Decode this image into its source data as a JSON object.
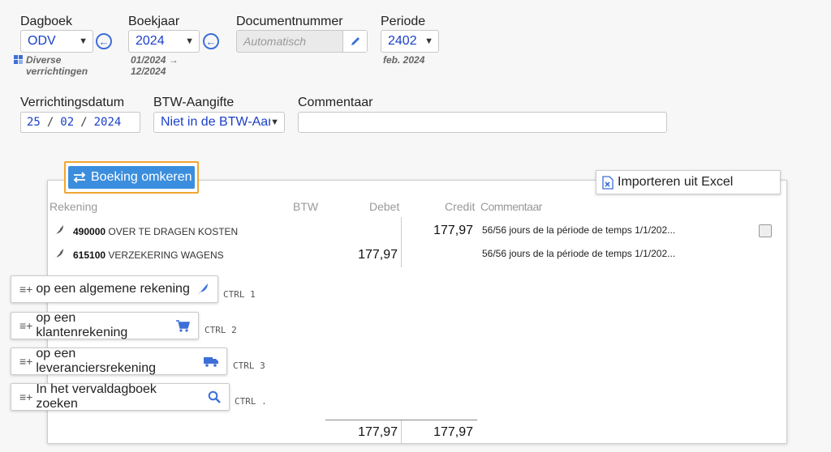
{
  "header": {
    "dagboek": {
      "label": "Dagboek",
      "value": "ODV",
      "sub": "Diverse verrichtingen"
    },
    "boekjaar": {
      "label": "Boekjaar",
      "value": "2024",
      "sub1": "01/2024 →",
      "sub2": "12/2024"
    },
    "documentnummer": {
      "label": "Documentnummer",
      "placeholder": "Automatisch"
    },
    "periode": {
      "label": "Periode",
      "value": "2402",
      "sub": "feb. 2024"
    },
    "verrichtingsdatum": {
      "label": "Verrichtingsdatum",
      "day": "25",
      "month": "02",
      "year": "2024"
    },
    "btw": {
      "label": "BTW-Aangifte",
      "value": "Niet in de BTW-Aang"
    },
    "commentaar": {
      "label": "Commentaar",
      "value": ""
    }
  },
  "actions": {
    "reverse_label": "Boeking omkeren",
    "import_label": "Importeren uit Excel"
  },
  "table": {
    "columns": {
      "rekening": "Rekening",
      "btw": "BTW",
      "debet": "Debet",
      "credit": "Credit",
      "commentaar": "Commentaar"
    },
    "rows": [
      {
        "code": "490000",
        "name": "OVER TE DRAGEN KOSTEN",
        "debet": "",
        "credit": "177,97",
        "comment": "56/56 jours de la période de temps 1/1/202..."
      },
      {
        "code": "615100",
        "name": "VERZEKERING WAGENS",
        "debet": "177,97",
        "credit": "",
        "comment": "56/56 jours de la période de temps 1/1/202..."
      }
    ],
    "totals": {
      "debet": "177,97",
      "credit": "177,97"
    }
  },
  "add_buttons": [
    {
      "prefix": "≡+",
      "label": "op een algemene rekening",
      "shortcut": "CTRL 1",
      "icon": "feather-icon"
    },
    {
      "prefix": "≡+",
      "label": "op een klantenrekening",
      "shortcut": "CTRL 2",
      "icon": "cart-icon"
    },
    {
      "prefix": "≡+",
      "label": "op een leveranciersrekening",
      "shortcut": "CTRL 3",
      "icon": "truck-icon"
    },
    {
      "prefix": "≡+",
      "label": "In het vervaldagboek zoeken",
      "shortcut": "CTRL .",
      "icon": "search-icon"
    }
  ],
  "colors": {
    "accent": "#3c6fd8",
    "value_text": "#1a3fc8",
    "reverse_btn": "#3b8ede",
    "reverse_border": "#f2a531"
  }
}
